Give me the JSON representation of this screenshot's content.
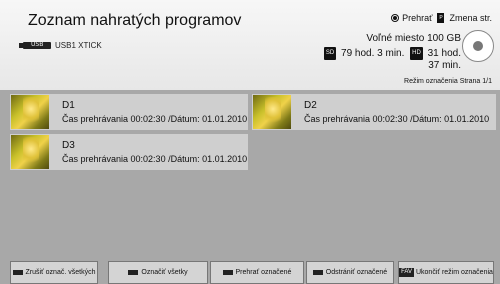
{
  "header": {
    "title": "Zoznam nahratých programov",
    "device": "USB1 XTICK",
    "play_label": "Prehrať",
    "page_change_label": "Zmena str.",
    "free_space": "Voľné miesto 100 GB",
    "sd_hours": "79 hod. 3 min.",
    "hd_hours": "31 hod.",
    "hd_minutes": "37 min.",
    "mark_mode": "Režim označenia",
    "page": "Strana 1/1"
  },
  "badges": {
    "sd": "SD",
    "hd": "HD",
    "pg": "P"
  },
  "recordings": [
    {
      "name": "D1",
      "meta": "Čas prehrávania 00:02:30 /Dátum: 01.01.2010"
    },
    {
      "name": "D2",
      "meta": "Čas prehrávania 00:02:30 /Dátum: 01.01.2010"
    },
    {
      "name": "D3",
      "meta": "Čas prehrávania 00:02:30 /Dátum: 01.01.2010"
    }
  ],
  "footer": {
    "unmark_all": "Zrušiť označ. všetkých",
    "mark_all": "Označiť všetky",
    "play_marked": "Prehrať označené",
    "delete_marked": "Odstrániť označené",
    "fav_label": "FAV",
    "exit_mark": "Ukončiť režim označenia"
  }
}
